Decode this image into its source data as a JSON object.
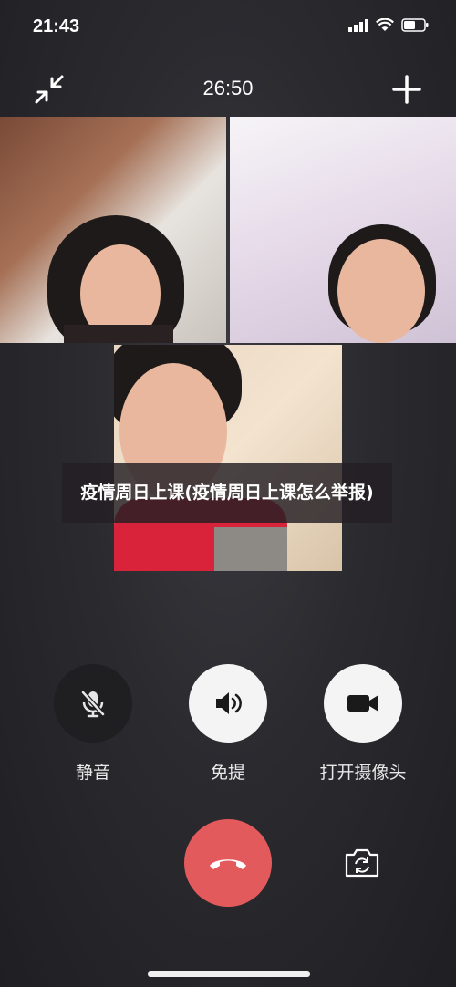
{
  "status_bar": {
    "time": "21:43"
  },
  "call": {
    "duration": "26:50"
  },
  "caption": {
    "text": "疫情周日上课(疫情周日上课怎么举报)"
  },
  "controls": {
    "mute_label": "静音",
    "speaker_label": "免提",
    "camera_label": "打开摄像头"
  },
  "icons": {
    "minimize": "minimize-arrows-icon",
    "add": "plus-icon",
    "mute": "mic-off-icon",
    "speaker": "speaker-icon",
    "camera": "video-camera-icon",
    "hangup": "phone-hangup-icon",
    "switch_camera": "camera-switch-icon"
  },
  "colors": {
    "hangup": "#e35a5c",
    "background": "#2a2a2f"
  }
}
